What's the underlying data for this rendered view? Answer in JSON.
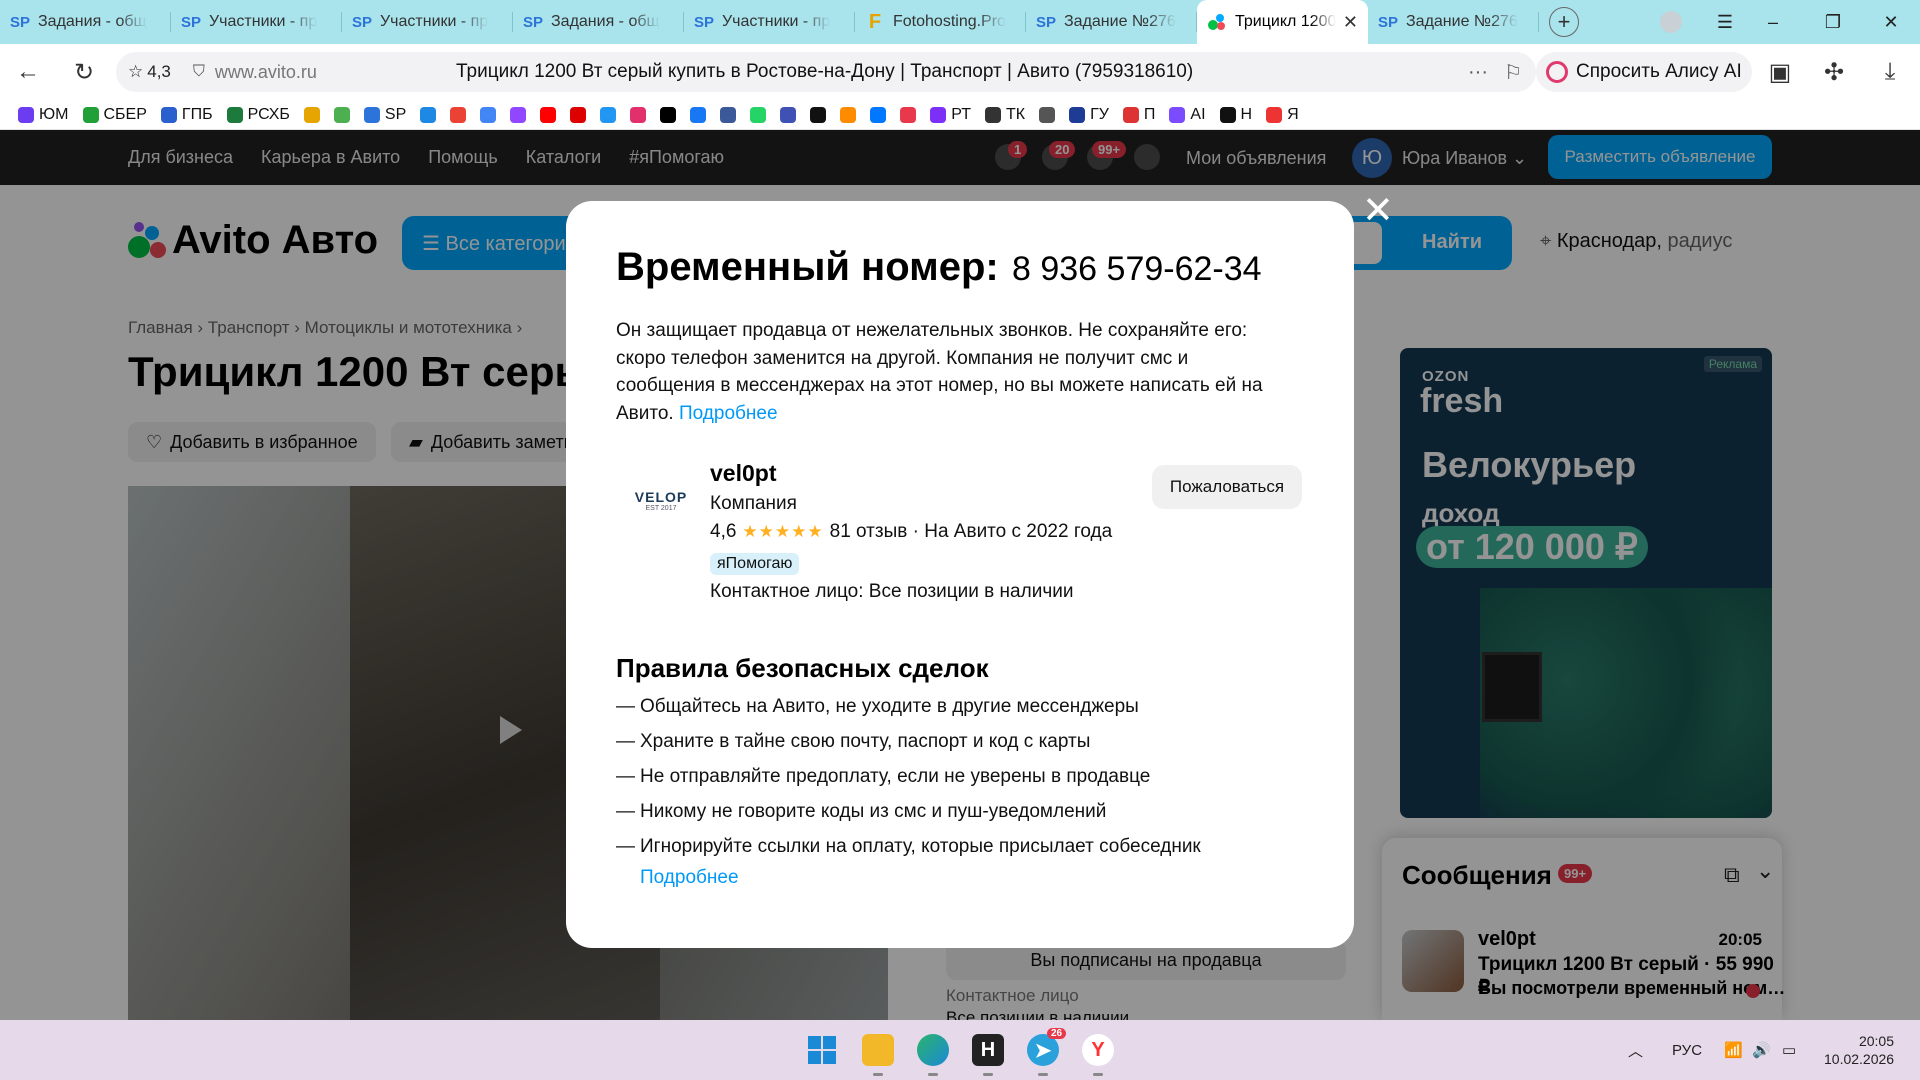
{
  "browser": {
    "tabs": [
      {
        "icon": "sp",
        "label": "Задания - общ"
      },
      {
        "icon": "sp",
        "label": "Участники - пр"
      },
      {
        "icon": "sp",
        "label": "Участники - пр"
      },
      {
        "icon": "sp",
        "label": "Задания - общ"
      },
      {
        "icon": "sp",
        "label": "Участники - пр"
      },
      {
        "icon": "fh",
        "label": "Fotohosting.Pro"
      },
      {
        "icon": "sp",
        "label": "Задание №276"
      },
      {
        "icon": "avito",
        "label": "Трицикл 1200",
        "active": true
      },
      {
        "icon": "sp",
        "label": "Задание №276"
      }
    ],
    "site_rating": "4,3",
    "domain": "www.avito.ru",
    "page_title": "Трицикл 1200 Вт серый купить в Ростове-на-Дону | Транспорт | Авито (7959318610)",
    "alice_button": "Спросить Алису AI",
    "bookmarks": [
      "ЮМ",
      "СБЕР",
      "ГПБ",
      "РСХБ",
      "",
      "",
      "SP",
      "",
      "",
      "",
      "",
      "",
      "",
      "",
      "",
      "",
      "",
      "",
      "",
      "",
      "",
      "",
      "",
      "",
      "РТ",
      "ТК",
      "",
      "ГУ",
      "П",
      "AI",
      "Н",
      "Я"
    ]
  },
  "avito": {
    "nav": [
      "Для бизнеса",
      "Карьера в Авито",
      "Помощь",
      "Каталоги",
      "#яПомогаю"
    ],
    "badges": {
      "favorites": "1",
      "notifications": "20",
      "messages": "99+"
    },
    "my_ads": "Мои объявления",
    "user_initial": "Ю",
    "user_name": "Юра Иванов",
    "post_button": "Разместить объявление",
    "logo_text": "Avito Авто",
    "search_category": "Все категории",
    "search_button": "Найти",
    "city": "Краснодар,",
    "city_suffix": "радиус",
    "breadcrumbs": "Главная › Транспорт › Мотоциклы и мототехника ›",
    "listing_title": "Трицикл 1200 Вт серый",
    "add_favorite": "Добавить в избранное",
    "add_note": "Добавить заметку",
    "subscribed": "Вы подписаны на продавца",
    "contact_label": "Контактное лицо",
    "contact_value": "Все позиции в наличии"
  },
  "ad": {
    "tag": "Реклама",
    "brand_top": "OZON",
    "brand": "fresh",
    "headline": "Велокурьер",
    "income_label": "доход",
    "income_value": "от 120 000 ₽"
  },
  "messages": {
    "title": "Сообщения",
    "count": "99+",
    "items": [
      {
        "name": "vel0pt",
        "time": "20:05",
        "item": "Трицикл 1200 Вт серый · 55 990 ₽",
        "preview": "Вы посмотрели временный ном…"
      }
    ]
  },
  "modal": {
    "title": "Временный номер:",
    "phone": "8 936 579-62-34",
    "description": "Он защищает продавца от нежелательных звонков. Не сохраняйте его: скоро телефон заменится на другой. Компания не получит смс и сообщения в мессенджерах на этот номер, но вы можете написать ей на Авито.",
    "more_link": "Подробнее",
    "seller": {
      "logo": "VELOP",
      "logo_sub": "EST 2017",
      "name": "vel0pt",
      "type": "Компания",
      "rating": "4,6",
      "reviews": "81 отзыв · На Авито с 2022 года",
      "badge": "яПомогаю",
      "contact": "Контактное лицо: Все позиции в наличии",
      "complain": "Пожаловаться"
    },
    "rules_title": "Правила безопасных сделок",
    "rules": [
      "Общайтесь на Авито, не уходите в другие мессенджеры",
      "Храните в тайне свою почту, паспорт и код с карты",
      "Не отправляйте предоплату, если не уверены в продавце",
      "Никому не говорите коды из смс и пуш-уведомлений",
      "Игнорируйте ссылки на оплату, которые присылает собеседник"
    ],
    "rules_more": "Подробнее"
  },
  "taskbar": {
    "telegram_badge": "26",
    "language": "РУС",
    "time": "20:05",
    "date": "10.02.2026"
  }
}
